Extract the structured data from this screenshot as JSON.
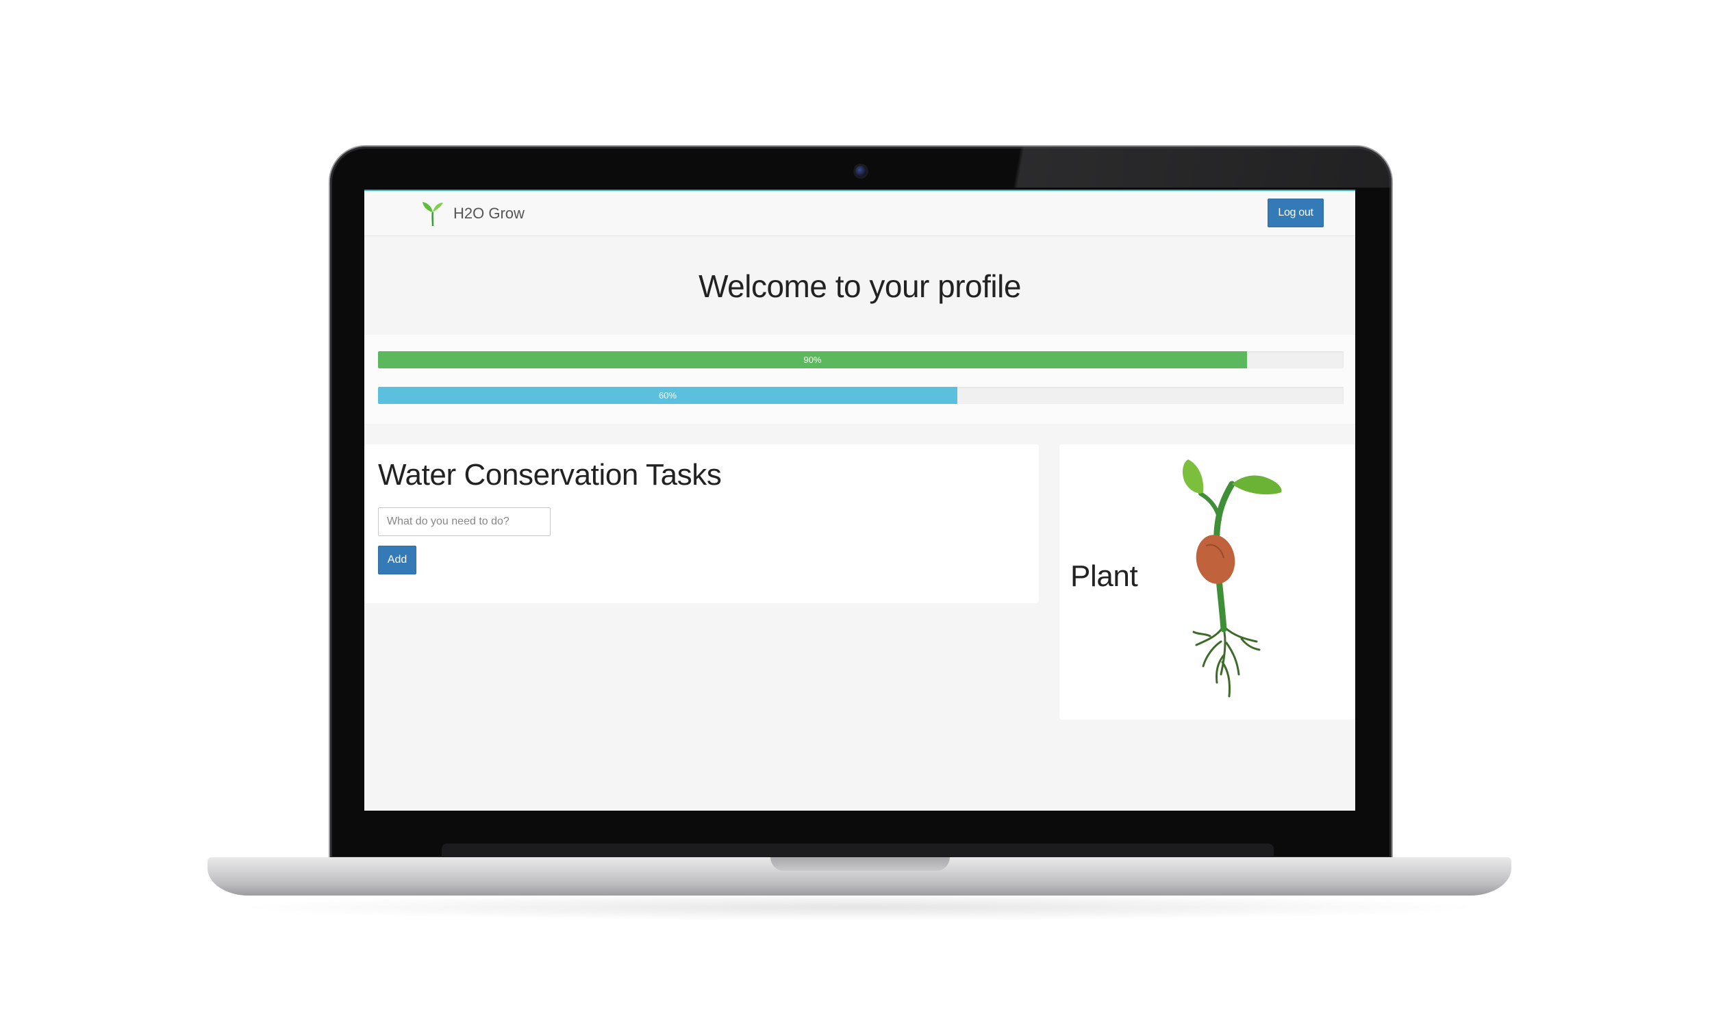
{
  "app": {
    "brand_name": "H2O Grow",
    "brand_icon": "sprout-icon"
  },
  "navbar": {
    "logout_label": "Log out"
  },
  "header": {
    "title": "Welcome to your profile"
  },
  "progress": [
    {
      "percent": 90,
      "label": "90%",
      "color": "#5cb85c"
    },
    {
      "percent": 60,
      "label": "60%",
      "color": "#5bc0de"
    }
  ],
  "tasks": {
    "title": "Water Conservation Tasks",
    "input_value": "",
    "input_placeholder": "What do you need to do?",
    "add_label": "Add"
  },
  "plant": {
    "label": "Plant",
    "image": "seedling-illustration"
  },
  "colors": {
    "primary": "#337ab7",
    "success": "#5cb85c",
    "info": "#5bc0de"
  }
}
